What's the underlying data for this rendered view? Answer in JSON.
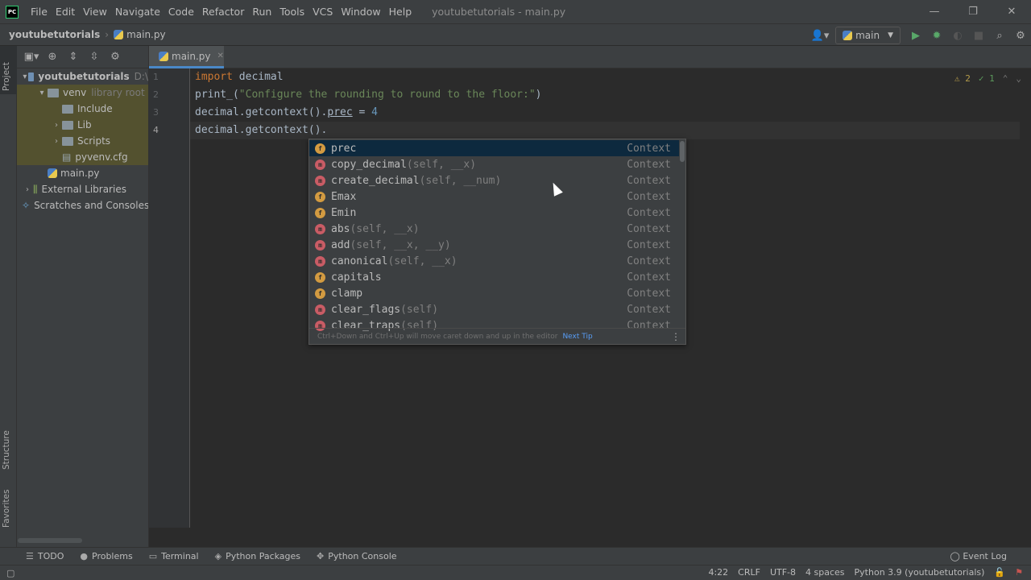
{
  "menubar": {
    "logo": "PC",
    "items": [
      "File",
      "Edit",
      "View",
      "Navigate",
      "Code",
      "Refactor",
      "Run",
      "Tools",
      "VCS",
      "Window",
      "Help"
    ],
    "window_title": "youtubetutorials - main.py"
  },
  "navbar": {
    "project": "youtubetutorials",
    "file": "main.py",
    "run_config": "main"
  },
  "side_tabs": {
    "project": "Project",
    "structure": "Structure",
    "favorites": "Favorites"
  },
  "project_tree": [
    {
      "label": "youtubetutorials",
      "sub": "D:\\",
      "indent": 0,
      "arrow": "▾",
      "kind": "folder-blue"
    },
    {
      "label": "venv",
      "sub": "library root",
      "indent": 1,
      "arrow": "▾",
      "kind": "folder"
    },
    {
      "label": "Include",
      "sub": "",
      "indent": 2,
      "arrow": "",
      "kind": "folder"
    },
    {
      "label": "Lib",
      "sub": "",
      "indent": 2,
      "arrow": "›",
      "kind": "folder"
    },
    {
      "label": "Scripts",
      "sub": "",
      "indent": 2,
      "arrow": "›",
      "kind": "folder"
    },
    {
      "label": "pyvenv.cfg",
      "sub": "",
      "indent": 2,
      "arrow": "",
      "kind": "file"
    },
    {
      "label": "main.py",
      "sub": "",
      "indent": 1,
      "arrow": "",
      "kind": "py"
    },
    {
      "label": "External Libraries",
      "sub": "",
      "indent": 0,
      "arrow": "›",
      "kind": "lib"
    },
    {
      "label": "Scratches and Consoles",
      "sub": "",
      "indent": 0,
      "arrow": "",
      "kind": "scratch"
    }
  ],
  "editor": {
    "tab": "main.py",
    "line_numbers": [
      "1",
      "2",
      "3",
      "4"
    ],
    "lines": {
      "l1_kw": "import",
      "l1_rest": " decimal",
      "l2_fn": "print",
      "l2_open": "_(",
      "l2_str": "\"Configure the rounding to round to the floor:\"",
      "l2_close": ")",
      "l3_a": "decimal.getcontext().",
      "l3_b": "prec",
      "l3_c": " = ",
      "l3_num": "4",
      "l4": "decimal.getcontext()."
    },
    "inspections": {
      "warnings": "⚠ 2",
      "checks": "✓ 1"
    }
  },
  "completion": {
    "items": [
      {
        "kind": "f",
        "name": "prec",
        "params": "",
        "type": "Context"
      },
      {
        "kind": "m",
        "name": "copy_decimal",
        "params": "(self, __x)",
        "type": "Context"
      },
      {
        "kind": "m",
        "name": "create_decimal",
        "params": "(self, __num)",
        "type": "Context"
      },
      {
        "kind": "f",
        "name": "Emax",
        "params": "",
        "type": "Context"
      },
      {
        "kind": "f",
        "name": "Emin",
        "params": "",
        "type": "Context"
      },
      {
        "kind": "m",
        "name": "abs",
        "params": "(self, __x)",
        "type": "Context"
      },
      {
        "kind": "m",
        "name": "add",
        "params": "(self, __x, __y)",
        "type": "Context"
      },
      {
        "kind": "m",
        "name": "canonical",
        "params": "(self, __x)",
        "type": "Context"
      },
      {
        "kind": "f",
        "name": "capitals",
        "params": "",
        "type": "Context"
      },
      {
        "kind": "f",
        "name": "clamp",
        "params": "",
        "type": "Context"
      },
      {
        "kind": "m",
        "name": "clear_flags",
        "params": "(self)",
        "type": "Context"
      },
      {
        "kind": "m",
        "name": "clear_traps",
        "params": "(self)",
        "type": "Context"
      }
    ],
    "footer": "Ctrl+Down and Ctrl+Up will move caret down and up in the editor",
    "next_tip": "Next Tip"
  },
  "bottom_tools": [
    "TODO",
    "Problems",
    "Terminal",
    "Python Packages",
    "Python Console"
  ],
  "event_log": "Event Log",
  "status": {
    "position": "4:22",
    "line_sep": "CRLF",
    "encoding": "UTF-8",
    "indent": "4 spaces",
    "interpreter": "Python 3.9 (youtubetutorials)"
  },
  "colors": {
    "keyword": "#cc7832",
    "string": "#6a8759",
    "number": "#6897bb",
    "accent": "#4a88c7"
  }
}
